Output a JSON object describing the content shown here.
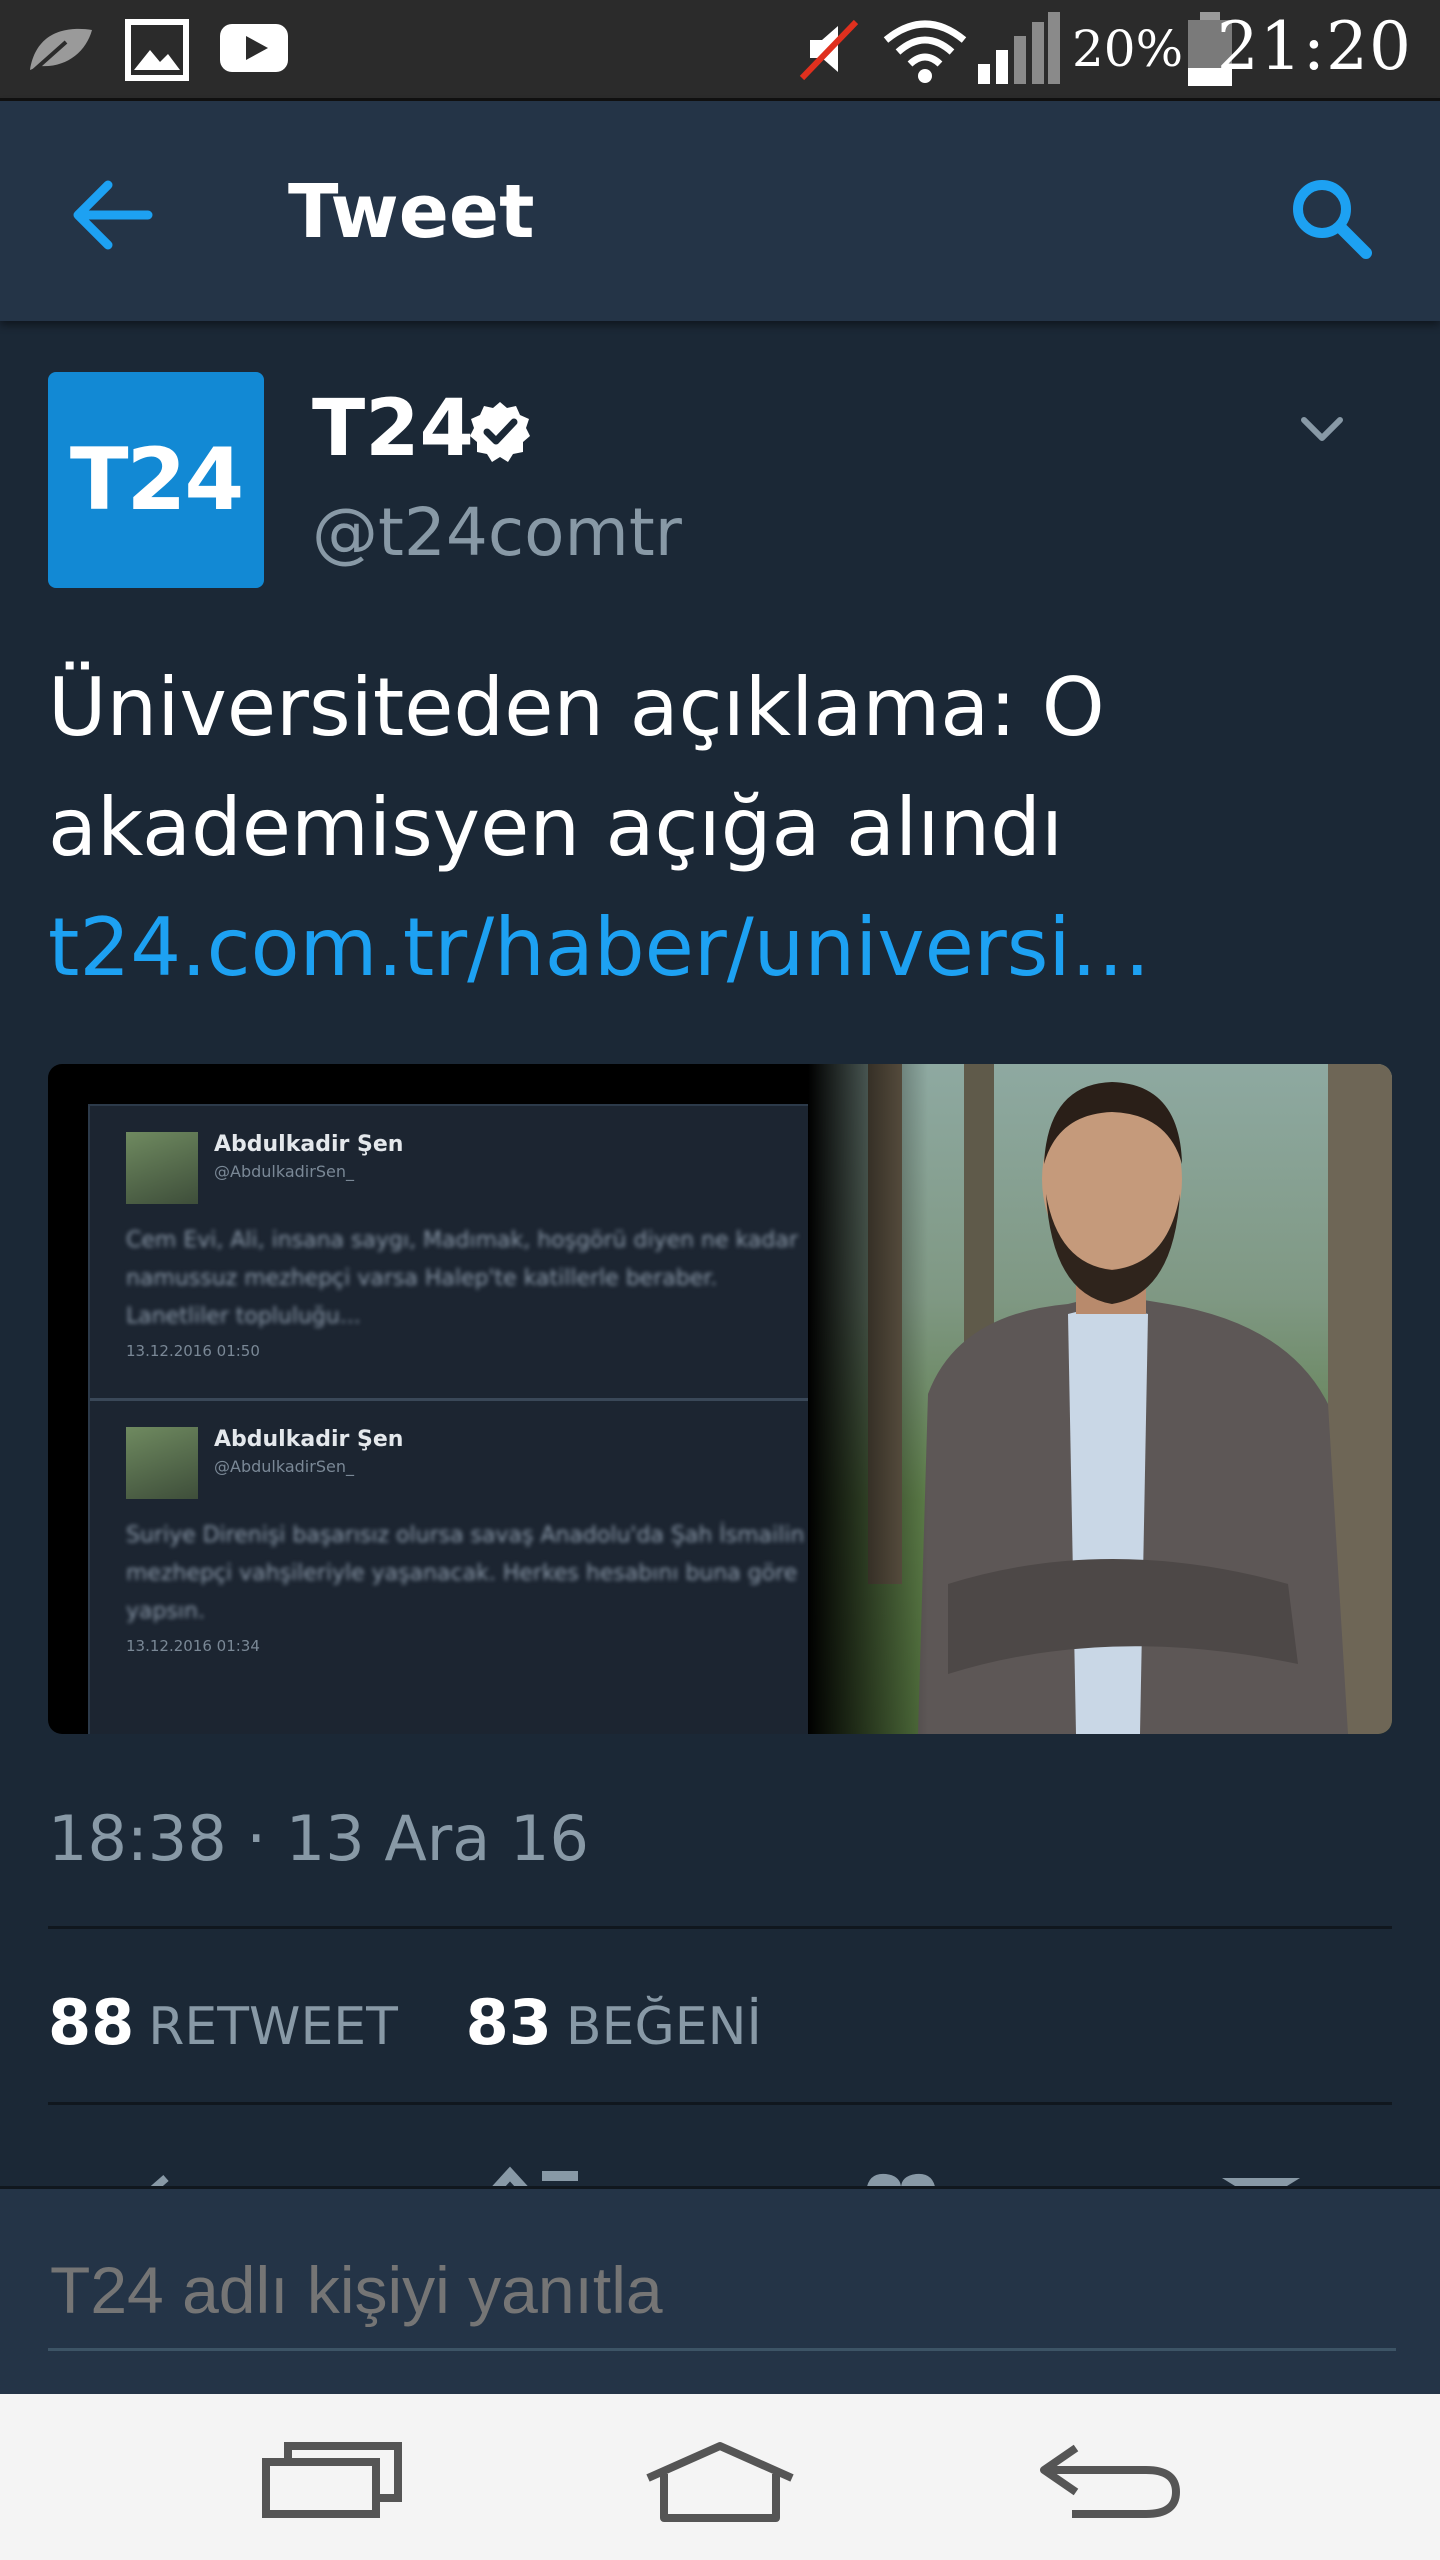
{
  "status_bar": {
    "battery_percent": "20%",
    "time": "21:20",
    "icons": [
      "leaf-icon",
      "gallery-icon",
      "youtube-icon",
      "mute-icon",
      "wifi-icon",
      "signal-icon",
      "battery-icon"
    ]
  },
  "app_bar": {
    "title": "Tweet",
    "back_icon": "arrow-left-icon",
    "search_icon": "search-icon"
  },
  "tweet": {
    "avatar_text": "T24",
    "author_name": "T24",
    "author_handle": "@t24comtr",
    "text_line1": "Üniversiteden açıklama: O",
    "text_line2": "akademisyen açığa alındı",
    "link": "t24.com.tr/haber/universi…",
    "timestamp": "18:38 · 13 Ara 16",
    "retweet_count": "88",
    "retweet_label": "RETWEET",
    "like_count": "83",
    "like_label": "BEĞENİ"
  },
  "media": {
    "cards": [
      {
        "name": "Abdulkadir Şen",
        "handle": "@AbdulkadirSen_",
        "body": "Cem Evi, Ali, insana saygı, Madımak, hoşgörü diyen ne kadar namussuz mezhepçi varsa Halep'te katillerle beraber. Lanetliler topluluğu...",
        "date": "13.12.2016 01:50"
      },
      {
        "name": "Abdulkadir Şen",
        "handle": "@AbdulkadirSen_",
        "body": "Suriye Direnişi başarısız olursa savaş Anadolu'da Şah İsmailin mezhepçi vahşileriyle yaşanacak. Herkes hesabını buna göre yapsın.",
        "date": "13.12.2016 01:34"
      }
    ]
  },
  "reply": {
    "placeholder": "T24 adlı kişiyi yanıtla"
  },
  "colors": {
    "background": "#1b2836",
    "app_bar": "#243447",
    "accent": "#1da1f2",
    "muted_text": "#8899a6",
    "avatar": "#1289d4"
  }
}
